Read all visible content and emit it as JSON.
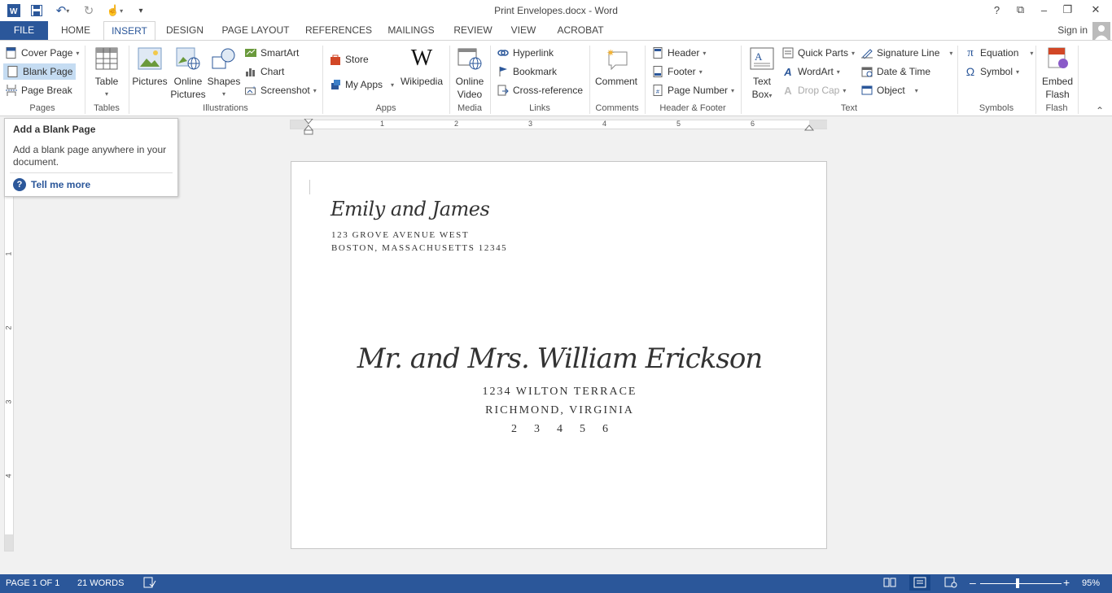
{
  "window": {
    "title": "Print Envelopes.docx - Word",
    "controls": [
      "?",
      "⧉",
      "–",
      "❐",
      "✕"
    ]
  },
  "tabs": [
    "FILE",
    "HOME",
    "INSERT",
    "DESIGN",
    "PAGE LAYOUT",
    "REFERENCES",
    "MAILINGS",
    "REVIEW",
    "VIEW",
    "ACROBAT"
  ],
  "active_tab": "INSERT",
  "signin": "Sign in",
  "ribbon": {
    "pages": {
      "label": "Pages",
      "cover_page": "Cover Page",
      "blank_page": "Blank Page",
      "page_break": "Page Break"
    },
    "tables": {
      "label": "Tables",
      "table": "Table"
    },
    "illustrations": {
      "label": "Illustrations",
      "pictures": "Pictures",
      "online_pictures_1": "Online",
      "online_pictures_2": "Pictures",
      "shapes": "Shapes",
      "smartart": "SmartArt",
      "chart": "Chart",
      "screenshot": "Screenshot"
    },
    "apps": {
      "label": "Apps",
      "store": "Store",
      "my_apps": "My Apps",
      "wikipedia": "Wikipedia"
    },
    "media": {
      "label": "Media",
      "online_video_1": "Online",
      "online_video_2": "Video"
    },
    "links": {
      "label": "Links",
      "hyperlink": "Hyperlink",
      "bookmark": "Bookmark",
      "cross_reference": "Cross-reference"
    },
    "comments": {
      "label": "Comments",
      "comment": "Comment"
    },
    "header_footer": {
      "label": "Header & Footer",
      "header": "Header",
      "footer": "Footer",
      "page_number": "Page Number"
    },
    "text": {
      "label": "Text",
      "text_box_1": "Text",
      "text_box_2": "Box",
      "quick_parts": "Quick Parts",
      "wordart": "WordArt",
      "drop_cap": "Drop Cap",
      "signature_line": "Signature Line",
      "date_time": "Date & Time",
      "object": "Object"
    },
    "symbols": {
      "label": "Symbols",
      "equation": "Equation",
      "symbol": "Symbol"
    },
    "flash": {
      "label": "Flash",
      "embed_flash_1": "Embed",
      "embed_flash_2": "Flash"
    }
  },
  "tooltip": {
    "title": "Add a Blank Page",
    "body": "Add a blank page anywhere in your document.",
    "more": "Tell me more"
  },
  "ruler": {
    "h_numbers": [
      "1",
      "2",
      "3",
      "4",
      "5",
      "6"
    ],
    "v_numbers": [
      "1",
      "2",
      "3",
      "4"
    ]
  },
  "envelope": {
    "return_name": "Emily and James",
    "return_line1": "123 GROVE AVENUE WEST",
    "return_line2": "BOSTON, MASSACHUSETTS 12345",
    "recipient_name": "Mr. and Mrs. William Erickson",
    "recipient_line1": "1234 WILTON TERRACE",
    "recipient_line2": "RICHMOND, VIRGINIA",
    "recipient_line3": "23456"
  },
  "status": {
    "page": "PAGE 1 OF 1",
    "words": "21 WORDS",
    "zoom": "95%",
    "zoom_level": 0.95
  },
  "colors": {
    "accent": "#2b579a"
  }
}
